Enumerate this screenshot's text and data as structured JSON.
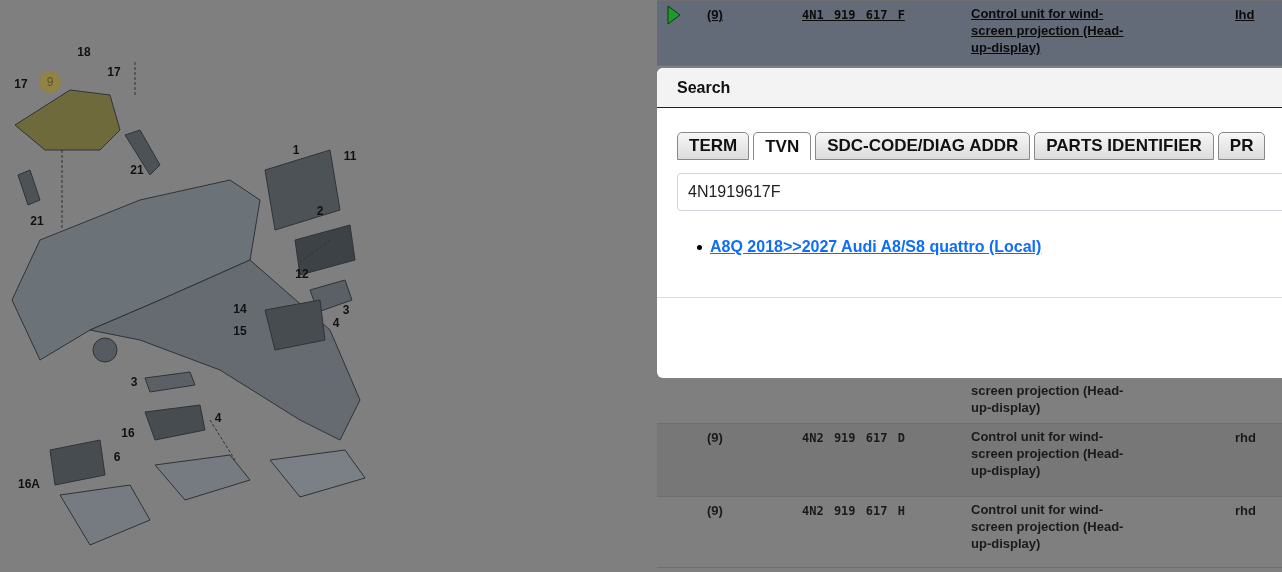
{
  "diagram": {
    "callouts": [
      {
        "label": "18",
        "selected": false
      },
      {
        "label": "17",
        "selected": false
      },
      {
        "label": "9",
        "selected": true
      },
      {
        "label": "17",
        "selected": false
      },
      {
        "label": "21",
        "selected": false
      },
      {
        "label": "21",
        "selected": false
      },
      {
        "label": "1",
        "selected": false
      },
      {
        "label": "11",
        "selected": false
      },
      {
        "label": "2",
        "selected": false
      },
      {
        "label": "12",
        "selected": false
      },
      {
        "label": "3",
        "selected": false
      },
      {
        "label": "14",
        "selected": false
      },
      {
        "label": "15",
        "selected": false
      },
      {
        "label": "4",
        "selected": false
      },
      {
        "label": "3",
        "selected": false
      },
      {
        "label": "4",
        "selected": false
      },
      {
        "label": "16",
        "selected": false
      },
      {
        "label": "6",
        "selected": false
      },
      {
        "label": "16A",
        "selected": false
      }
    ]
  },
  "table": {
    "rows": [
      {
        "selected": true,
        "position": "(9)",
        "part_number": "4N1 919 617 F",
        "description": "Control unit for wind-screen projection (Head-up-display)",
        "remark": "lhd"
      },
      {
        "selected": false,
        "description": "screen projection (Head-up-display)"
      },
      {
        "selected": false,
        "position": "(9)",
        "part_number": "4N2 919 617 D",
        "description": "Control unit for wind-screen projection (Head-up-display)",
        "remark": "rhd"
      },
      {
        "selected": false,
        "position": "(9)",
        "part_number": "4N2 919 617 H",
        "description": "Control unit for wind-screen projection (Head-up-display)",
        "remark": "rhd"
      }
    ]
  },
  "search_dialog": {
    "title": "Search",
    "tabs": [
      {
        "label": "TERM",
        "selected": false
      },
      {
        "label": "TVN",
        "selected": true
      },
      {
        "label": "SDC-CODE/DIAG ADDR",
        "selected": false
      },
      {
        "label": "PARTS IDENTIFIER",
        "selected": false
      },
      {
        "label": "PR",
        "selected": false
      }
    ],
    "search_field": {
      "value": "4N1919617F"
    },
    "results": [
      "A8Q 2018>>2027 Audi A8/S8 quattro (Local)"
    ]
  }
}
